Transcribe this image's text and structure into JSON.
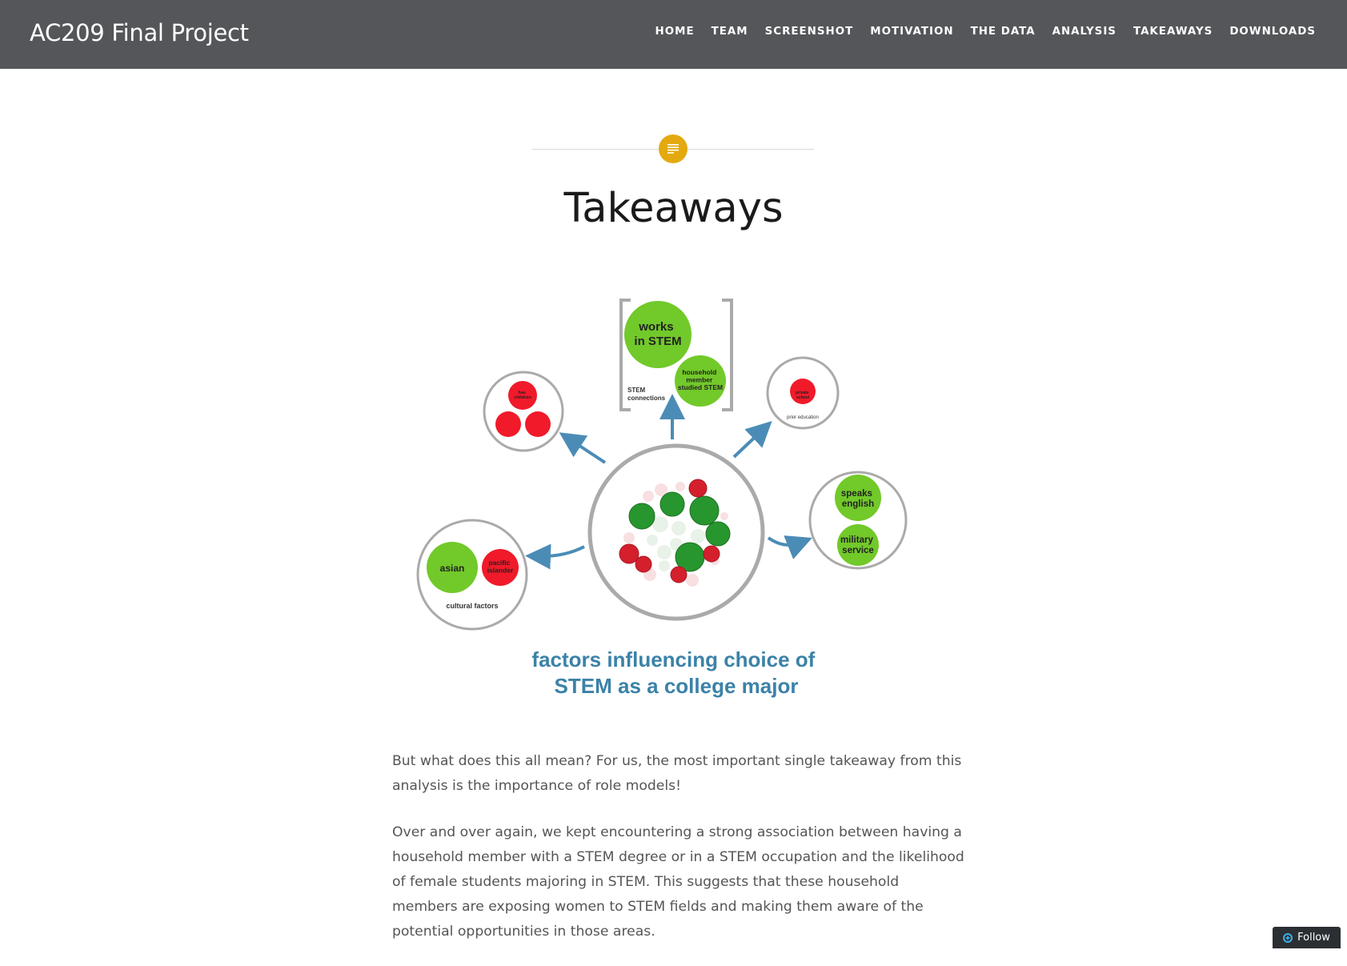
{
  "site": {
    "title": "AC209 Final Project"
  },
  "nav": {
    "items": [
      {
        "label": "HOME"
      },
      {
        "label": "TEAM"
      },
      {
        "label": "SCREENSHOT"
      },
      {
        "label": "MOTIVATION"
      },
      {
        "label": "THE DATA"
      },
      {
        "label": "ANALYSIS"
      },
      {
        "label": "TAKEAWAYS"
      },
      {
        "label": "DOWNLOADS"
      }
    ]
  },
  "entry": {
    "format_icon": "text-lines-icon",
    "title": "Takeaways"
  },
  "figure": {
    "caption_line1": "factors influencing choice of",
    "caption_line2": "STEM as a college major",
    "groups": {
      "stem_connections": {
        "label": "STEM connections",
        "items": [
          "works in STEM",
          "household member studied STEM"
        ]
      },
      "family": {
        "items": [
          "has children",
          "",
          ""
        ]
      },
      "prior_education": {
        "label": "prior education",
        "items": [
          "private school"
        ]
      },
      "language_service": {
        "items": [
          "speaks english",
          "military service"
        ]
      },
      "cultural_factors": {
        "label": "cultural factors",
        "items": [
          "asian",
          "pacific islander"
        ]
      }
    },
    "colors": {
      "positive": "#72c92a",
      "negative": "#f01a2a",
      "arrow": "#4b8cb6",
      "ring": "#aaaaaa",
      "caption": "#3b82a8"
    }
  },
  "content": {
    "paragraphs": [
      "But what does this all mean? For us, the most important single takeaway from this analysis is the importance of role models!",
      "Over and over again, we kept encountering a strong association between having a household member with a STEM degree or in a STEM occupation and the likelihood of female students majoring in STEM. This suggests that these household members are exposing women to STEM fields and making them aware of the potential opportunities in those areas."
    ]
  },
  "follow": {
    "label": "Follow",
    "icon": "follow-plus-icon"
  }
}
